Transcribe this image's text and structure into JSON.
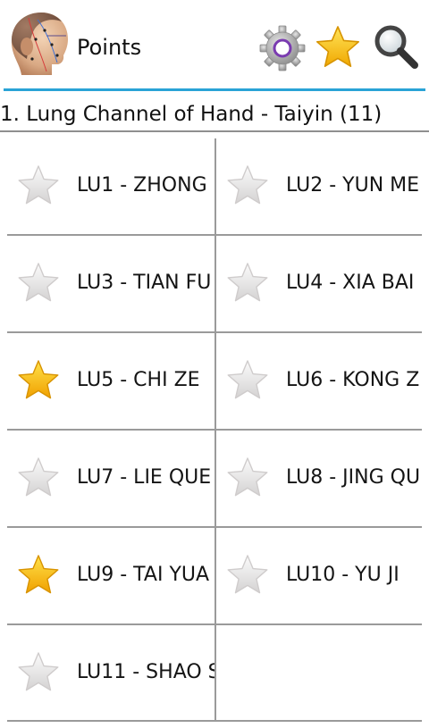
{
  "header": {
    "title": "Points",
    "avatar_icon": "head-acupuncture-icon",
    "settings_icon": "gear-icon",
    "favorites_icon": "star-icon",
    "search_icon": "search-icon",
    "accent_color": "#2aa3d6"
  },
  "section": {
    "title": "1. Lung Channel of Hand - Taiyin (11)"
  },
  "points": [
    {
      "label": "LU1 - ZHONG",
      "favorite": false
    },
    {
      "label": "LU2 - YUN ME",
      "favorite": false
    },
    {
      "label": "LU3 - TIAN FU",
      "favorite": false
    },
    {
      "label": "LU4 - XIA BAI",
      "favorite": false
    },
    {
      "label": "LU5 - CHI ZE",
      "favorite": true
    },
    {
      "label": "LU6 - KONG Z",
      "favorite": false
    },
    {
      "label": "LU7 - LIE QUE",
      "favorite": false
    },
    {
      "label": "LU8 - JING QU",
      "favorite": false
    },
    {
      "label": "LU9 - TAI YUA",
      "favorite": true
    },
    {
      "label": "LU10 - YU JI",
      "favorite": false
    },
    {
      "label": "LU11 - SHAO S",
      "favorite": false
    }
  ]
}
